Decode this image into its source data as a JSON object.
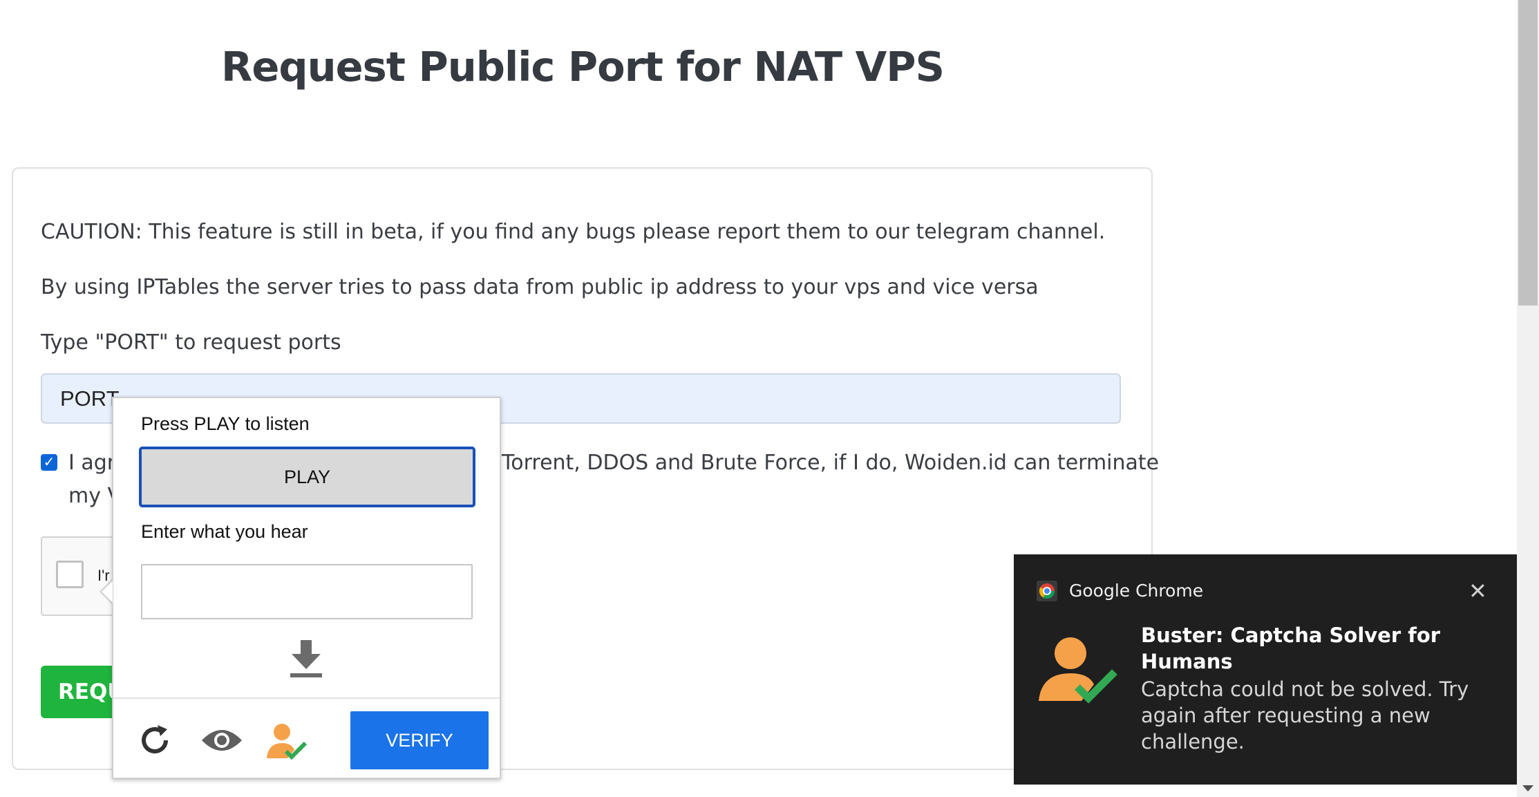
{
  "page": {
    "title": "Request Public Port for NAT VPS"
  },
  "form": {
    "caution": "CAUTION: This feature is still in beta, if you find any bugs please report them to our telegram channel.",
    "description": "By using IPTables the server tries to pass data from public ip address to your vps and vice versa",
    "type_label": "Type \"PORT\" to request ports",
    "port_value": "PORT",
    "agree_prefix": "I agr",
    "agree_visible": "Torrent, DDOS and Brute Force, if I do, Woiden.id can terminate",
    "agree_line2": "my V",
    "recaptcha_text": "I'r",
    "request_button": "REQU"
  },
  "captcha_popup": {
    "listen_label": "Press PLAY to listen",
    "play_button": "PLAY",
    "enter_label": "Enter what you hear",
    "answer_value": "",
    "verify_button": "VERIFY",
    "icons": [
      "reload-icon",
      "eye-icon",
      "buster-solver-icon",
      "download-icon"
    ]
  },
  "notification": {
    "app_name": "Google Chrome",
    "title": "Buster: Captcha Solver for Humans",
    "body": "Captcha could not be solved. Try again after requesting a new challenge.",
    "accent_orange": "#f5a14a",
    "accent_green": "#33a853"
  },
  "colors": {
    "request_button": "#1fb43e",
    "verify_button": "#1a73e8",
    "input_bg": "#e8f0fe"
  }
}
